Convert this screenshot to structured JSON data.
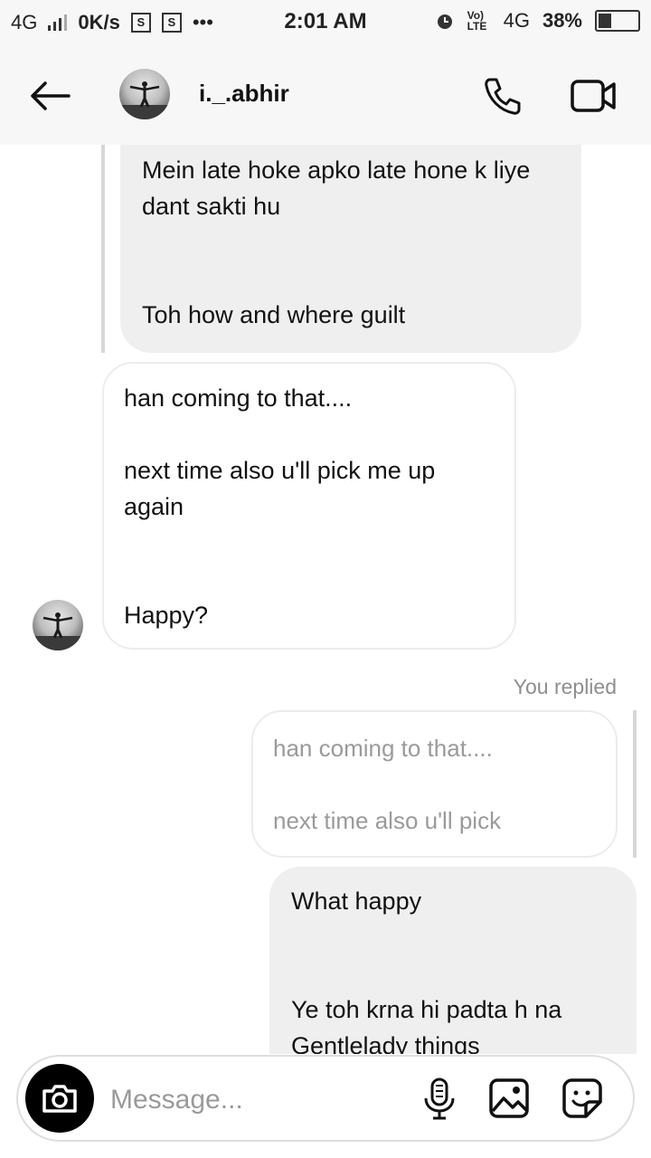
{
  "status_bar": {
    "network": "4G",
    "speed": "0K/s",
    "sim_badge": "S",
    "more": "•••",
    "time": "2:01 AM",
    "volte": "Vo) LTE",
    "network2": "4G",
    "battery": "38%"
  },
  "header": {
    "username": "i._.abhir"
  },
  "messages": [
    {
      "text": "Mein late hoke apko late hone k liye dant sakti hu\n\n\nToh how and where guilt"
    },
    {
      "text": "han coming to that....\n\nnext time also u'll pick me up again\n\n\nHappy?"
    },
    {
      "label": "You replied"
    },
    {
      "text": "han coming to that....\n\nnext time also u'll pick"
    },
    {
      "text": "What happy\n\n\nYe toh krna hi padta h na Gentlelady things"
    }
  ],
  "composer": {
    "placeholder": "Message..."
  },
  "icons": {
    "back": "arrow-left",
    "call": "phone",
    "video": "video-camera",
    "camera": "camera",
    "mic": "microphone",
    "gallery": "image",
    "sticker": "sticker"
  }
}
